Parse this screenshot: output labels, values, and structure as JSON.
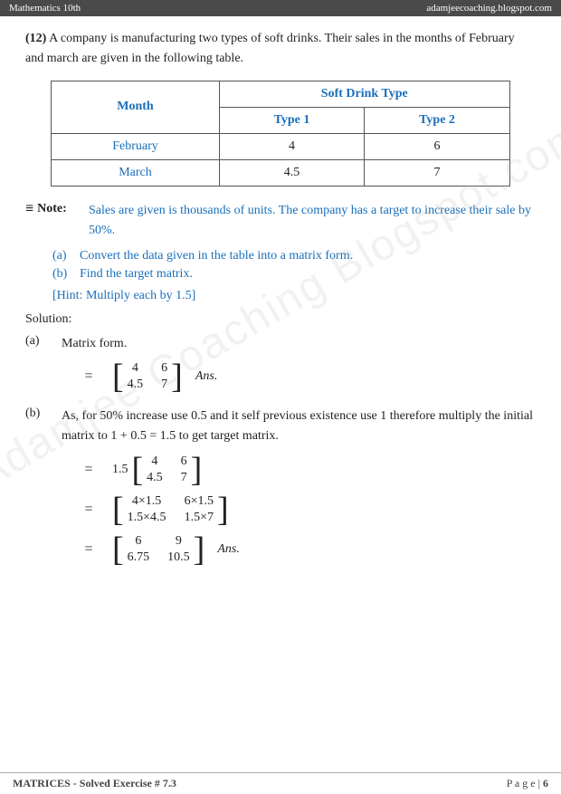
{
  "header": {
    "left": "Mathematics 10th",
    "right": "adamjeecoaching.blogspot.com"
  },
  "question": {
    "number": "(12)",
    "text": "A company is manufacturing two types of soft drinks. Their sales in the months of February and march are given in the following table."
  },
  "table": {
    "col_header_1": "Month",
    "col_header_soft_drink": "Soft Drink Type",
    "col_type1": "Type 1",
    "col_type2": "Type 2",
    "rows": [
      {
        "month": "February",
        "type1": "4",
        "type2": "6"
      },
      {
        "month": "March",
        "type1": "4.5",
        "type2": "7"
      }
    ]
  },
  "note": {
    "label": "Note:",
    "text": "Sales are given is thousands of units. The company has a target to increase their sale by 50%."
  },
  "sub_items": [
    {
      "label": "(a)",
      "text": "Convert the data given in the table into a matrix form."
    },
    {
      "label": "(b)",
      "text": "Find the target matrix."
    }
  ],
  "hint": "[Hint: Multiply each by 1.5]",
  "solution": {
    "label": "Solution:",
    "parts": [
      {
        "label": "(a)",
        "title": "Matrix form.",
        "matrix_equals": "=",
        "matrix": [
          [
            "4",
            "6"
          ],
          [
            "4.5",
            "7"
          ]
        ],
        "ans": "Ans."
      }
    ],
    "part_b": {
      "label": "(b)",
      "text1": "As, for 50% increase use 0.5 and it self previous existence use 1 therefore multiply the initial matrix to 1 + 0.5 = 1.5 to get target matrix.",
      "step1_equals": "=",
      "step1_multiplier": "1.5",
      "step1_matrix": [
        [
          "4",
          "6"
        ],
        [
          "4.5",
          "7"
        ]
      ],
      "step2_equals": "=",
      "step2_matrix": [
        [
          "4×1.5",
          "6×1.5"
        ],
        [
          "1.5×4.5",
          "1.5×7"
        ]
      ],
      "step3_equals": "=",
      "step3_matrix": [
        [
          "6",
          "9"
        ],
        [
          "6.75",
          "10.5"
        ]
      ],
      "ans": "Ans."
    }
  },
  "footer": {
    "left": "MATRICES - Solved Exercise # 7.3",
    "right_prefix": "P a g e |",
    "page_num": "6"
  },
  "watermark": "Adamjee Coaching Blogspot.com"
}
